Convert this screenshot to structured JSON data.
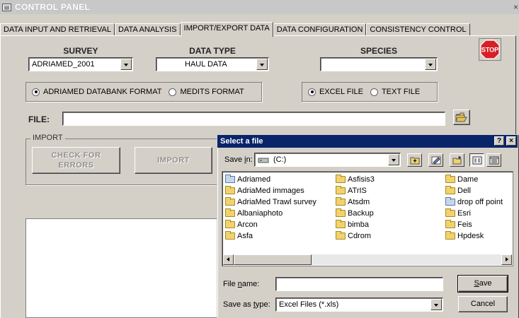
{
  "window": {
    "title": "CONTROL PANEL",
    "close_glyph": "×"
  },
  "tabs": [
    {
      "label": "DATA INPUT AND RETRIEVAL"
    },
    {
      "label": "DATA ANALYSIS"
    },
    {
      "label": "IMPORT/EXPORT DATA",
      "active": true
    },
    {
      "label": "DATA CONFIGURATION"
    },
    {
      "label": "CONSISTENCY CONTROL"
    }
  ],
  "survey": {
    "label": "SURVEY",
    "value": "ADRIAMED_2001"
  },
  "data_type": {
    "label": "DATA TYPE",
    "value": "HAUL DATA"
  },
  "species": {
    "label": "SPECIES",
    "value": ""
  },
  "stop_button": {
    "label": "STOP",
    "color": "#d81f26"
  },
  "format_options": [
    {
      "label": "ADRIAMED DATABANK FORMAT",
      "selected": true
    },
    {
      "label": "MEDITS FORMAT",
      "selected": false
    }
  ],
  "file_type_options": [
    {
      "label": "EXCEL FILE",
      "selected": true
    },
    {
      "label": "TEXT FILE",
      "selected": false
    }
  ],
  "file": {
    "label": "FILE:",
    "value": ""
  },
  "import_group": {
    "legend": "IMPORT",
    "check_button": "CHECK FOR ERRORS",
    "import_button": "IMPORT"
  },
  "dialog": {
    "title": "Select a file",
    "help_glyph": "?",
    "close_glyph": "×",
    "save_in": {
      "label_pre": "Save ",
      "label_key": "i",
      "label_post": "n:",
      "value": "(C:)"
    },
    "columns": [
      [
        {
          "name": "Adriamed",
          "icon": "network-folder-icon"
        },
        {
          "name": "AdriaMed immages",
          "icon": "folder-icon"
        },
        {
          "name": "AdriaMed Trawl survey",
          "icon": "folder-icon"
        },
        {
          "name": "Albaniaphoto",
          "icon": "folder-icon"
        },
        {
          "name": "Arcon",
          "icon": "folder-icon"
        },
        {
          "name": "Asfa",
          "icon": "folder-icon"
        }
      ],
      [
        {
          "name": "Asfisis3",
          "icon": "folder-icon"
        },
        {
          "name": "ATrIS",
          "icon": "folder-icon"
        },
        {
          "name": "Atsdm",
          "icon": "folder-icon"
        },
        {
          "name": "Backup",
          "icon": "folder-icon"
        },
        {
          "name": "bimba",
          "icon": "folder-icon"
        },
        {
          "name": "Cdrom",
          "icon": "folder-icon"
        }
      ],
      [
        {
          "name": "Dame",
          "icon": "folder-icon"
        },
        {
          "name": "Dell",
          "icon": "folder-icon"
        },
        {
          "name": "drop off point",
          "icon": "network-folder-icon"
        },
        {
          "name": "Esri",
          "icon": "folder-icon"
        },
        {
          "name": "Feis",
          "icon": "folder-icon"
        },
        {
          "name": "Hpdesk",
          "icon": "folder-icon"
        }
      ]
    ],
    "file_name": {
      "label_pre": "File ",
      "label_key": "n",
      "label_post": "ame:",
      "value": ""
    },
    "save_as_type": {
      "label_pre": "Save as ",
      "label_key": "t",
      "label_post": "ype:",
      "value": "Excel Files (*.xls)"
    },
    "save_button": {
      "label_key": "S",
      "label_post": "ave"
    },
    "cancel_button": "Cancel"
  }
}
